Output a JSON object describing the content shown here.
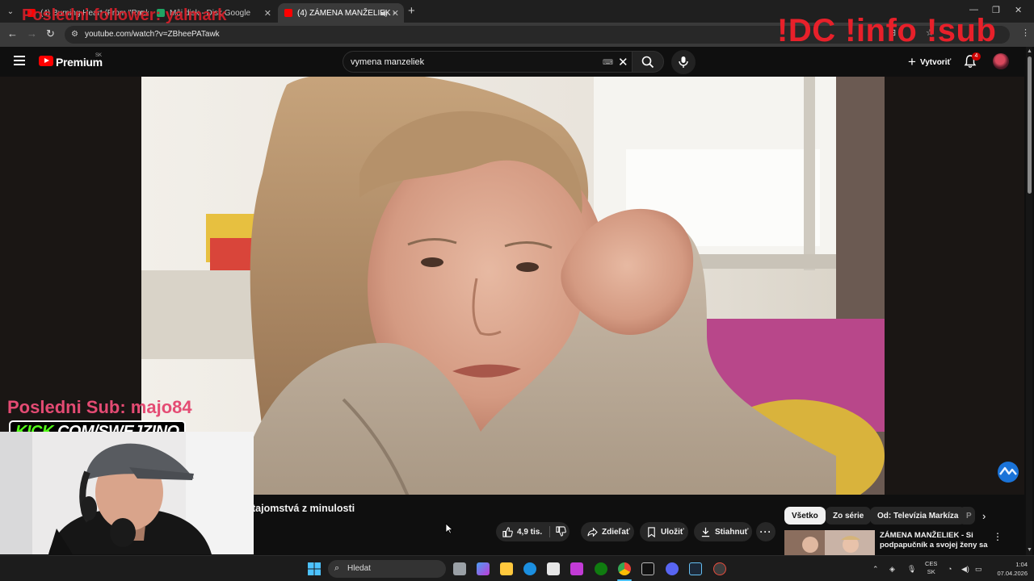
{
  "browser": {
    "tabs": [
      {
        "title": "(4) Burning Heart (From \"Rock",
        "favicon_color": "#ff0000"
      },
      {
        "title": "Môj disk - Disk Google",
        "favicon_color": "#1fa463"
      },
      {
        "title": "(4) ZÁMENA MANŽELIEK -",
        "favicon_color": "#ff0000",
        "active": true
      }
    ],
    "url": "youtube.com/watch?v=ZBheePATawk"
  },
  "overlays": {
    "last_follower": "Posledni follower: yalmark",
    "commands": "!DC !info !sub",
    "last_sub": "Posledni Sub: majo84",
    "kick_prefix": "KICK",
    "kick_suffix": ".COM/SWEJZINO"
  },
  "youtube": {
    "brand": "Premium",
    "region": "SK",
    "search_value": "vymena manzeliek",
    "create_label": "Vytvoriť",
    "notification_count": "4",
    "video_title": "tajomstvá z minulosti",
    "likes": "4,9 tis.",
    "share_label": "Zdieľať",
    "save_label": "Uložiť",
    "download_label": "Stiahnuť",
    "chips": [
      "Všetko",
      "Zo série",
      "Od: Televízia Markíza",
      "P"
    ],
    "recommended": {
      "title": "ZÁMENA MANŽELIEK - Si podpapučník a svojej ženy sa ..."
    }
  },
  "taskbar": {
    "search_placeholder": "Hledat",
    "lang_top": "CES",
    "lang_bottom": "SK",
    "time": "1:04",
    "date": "07.04.2026",
    "app_colors": [
      "#3a9bf0",
      "#9aa0a6",
      "#4a9ef5",
      "#ffc83d",
      "#1b8fe0",
      "#e6e6e6",
      "#c23bd6",
      "#107c10",
      "#4285f4",
      "#ffffff",
      "#5865f2",
      "#66c0f4",
      "#e74c3c"
    ]
  }
}
